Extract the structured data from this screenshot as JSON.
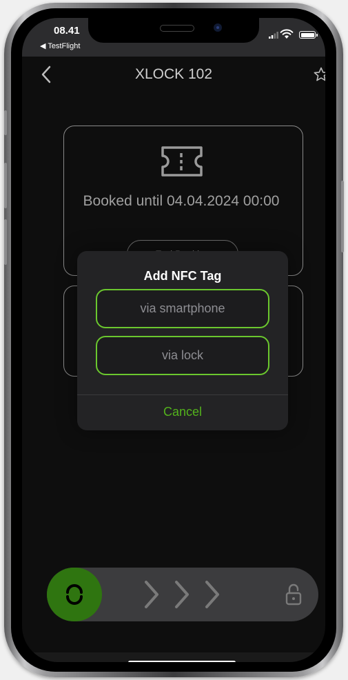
{
  "status_bar": {
    "time": "08.41",
    "back_app": "◀ TestFlight"
  },
  "nav": {
    "title": "XLOCK 102",
    "back_icon": "chevron-left-icon",
    "favorite_icon": "star-outline-icon"
  },
  "booking_card": {
    "icon": "ticket-icon",
    "booked_label": "Booked until 04.04.2024 00:00",
    "end_booking_label": "End Booking"
  },
  "dialog": {
    "title": "Add NFC Tag",
    "options": [
      {
        "label": "via smartphone"
      },
      {
        "label": "via lock"
      }
    ],
    "cancel_label": "Cancel"
  },
  "slider": {
    "handle_icon": "swap-vertical-icon",
    "arrows_icon": "chevrons-right-icon",
    "lock_icon": "unlocked-padlock-icon"
  },
  "colors": {
    "accent_green": "#53b21c",
    "border_green": "#6bc82e",
    "knob_green": "#2f7510",
    "background": "#0e0e0e"
  }
}
